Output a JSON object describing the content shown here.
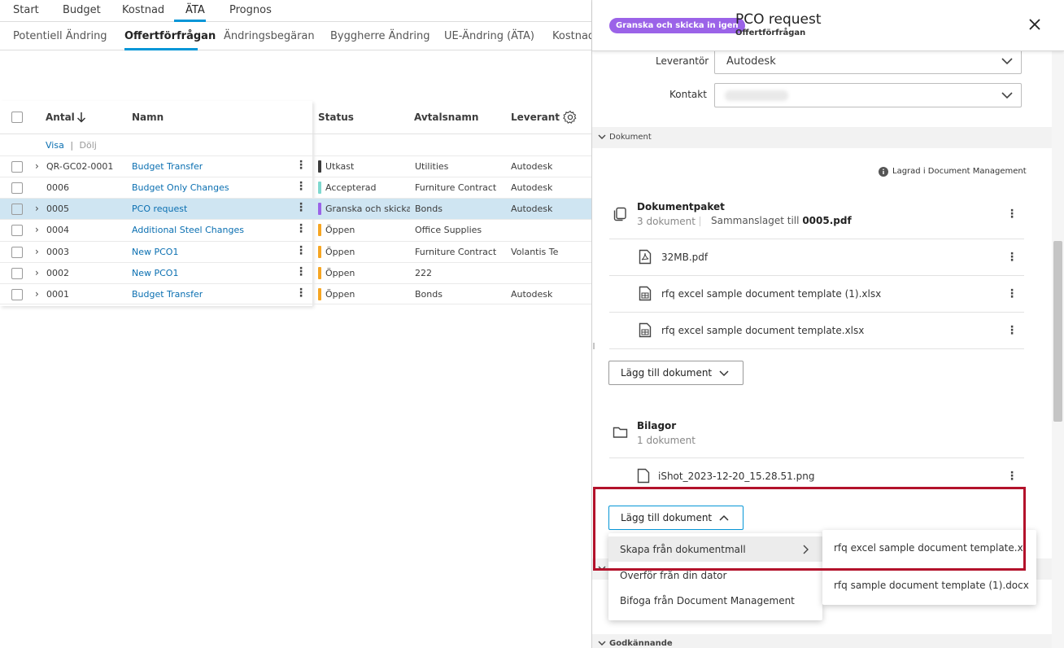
{
  "top_tabs": [
    {
      "label": "Start"
    },
    {
      "label": "Budget"
    },
    {
      "label": "Kostnad"
    },
    {
      "label": "ÄTA"
    },
    {
      "label": "Prognos"
    }
  ],
  "sub_tabs": [
    {
      "label": "Potentiell Ändring"
    },
    {
      "label": "Offertförfrågan"
    },
    {
      "label": "Ändringsbegäran"
    },
    {
      "label": "Byggherre Ändring"
    },
    {
      "label": "UE-Ändring (ÄTA)"
    },
    {
      "label": "Kostnad"
    }
  ],
  "table": {
    "headers": {
      "antal": "Antal",
      "namn": "Namn",
      "status": "Status",
      "avtalsnamn": "Avtalsnamn",
      "leverantor": "Leverantö"
    },
    "visa": "Visa",
    "separator": "|",
    "dolj": "Dölj",
    "rows": [
      {
        "antal": "QR-GC02-0001",
        "namn": "Budget Transfer",
        "status": "Utkast",
        "status_color": "#3c3c3c",
        "avtal": "Utilities",
        "lev": "Autodesk"
      },
      {
        "antal": "0006",
        "namn": "Budget Only Changes",
        "status": "Accepterad",
        "status_color": "#7fd8cf",
        "avtal": "Furniture Contract",
        "lev": "Autodesk"
      },
      {
        "antal": "0005",
        "namn": "PCO request",
        "status": "Granska och skicka ...",
        "status_color": "#9b63e8",
        "avtal": "Bonds",
        "lev": "Autodesk"
      },
      {
        "antal": "0004",
        "namn": "Additional Steel Changes",
        "status": "Öppen",
        "status_color": "#f6a623",
        "avtal": "Office Supplies",
        "lev": ""
      },
      {
        "antal": "0003",
        "namn": "New PCO1",
        "status": "Öppen",
        "status_color": "#f6a623",
        "avtal": "Furniture Contract",
        "lev": "Volantis Tes"
      },
      {
        "antal": "0002",
        "namn": "New PCO1",
        "status": "Öppen",
        "status_color": "#f6a623",
        "avtal": "222",
        "lev": ""
      },
      {
        "antal": "0001",
        "namn": "Budget Transfer",
        "status": "Öppen",
        "status_color": "#f6a623",
        "avtal": "Bonds",
        "lev": "Autodesk"
      }
    ]
  },
  "panel": {
    "status_pill": "Granska och skicka in igen",
    "title": "PCO request",
    "subtitle": "Offertförfrågan",
    "leverantor_label": "Leverantör",
    "leverantor_value": "Autodesk",
    "kontakt_label": "Kontakt",
    "dokument_section": "Dokument",
    "stored_note": "Lagrad i Document Management",
    "paket_title": "Dokumentpaket",
    "paket_count": "3 dokument",
    "paket_merged_prefix": "Sammanslaget till",
    "paket_merged_file": "0005.pdf",
    "files": [
      "32MB.pdf",
      "rfq excel sample document template (1).xlsx",
      "rfq excel sample document template.xlsx"
    ],
    "add_doc_label": "Lägg till dokument",
    "bilagor_title": "Bilagor",
    "bilagor_count": "1 dokument",
    "bilaga_file": "iShot_2023-12-20_15.28.51.png",
    "add_doc_label2": "Lägg till dokument",
    "godkannande_section": "Godkännande"
  },
  "menu": {
    "items": [
      "Skapa från dokumentmall",
      "Överför från din dator",
      "Bifoga från Document Management"
    ],
    "submenu": [
      "rfq excel sample document template.xl...",
      "rfq sample document template (1).docx"
    ]
  },
  "colors": {
    "accent": "#0696d7",
    "pill": "#9b63e8",
    "highlight": "#b3122b",
    "selected_row": "#cfe5f2",
    "link": "#0a6fb1"
  }
}
